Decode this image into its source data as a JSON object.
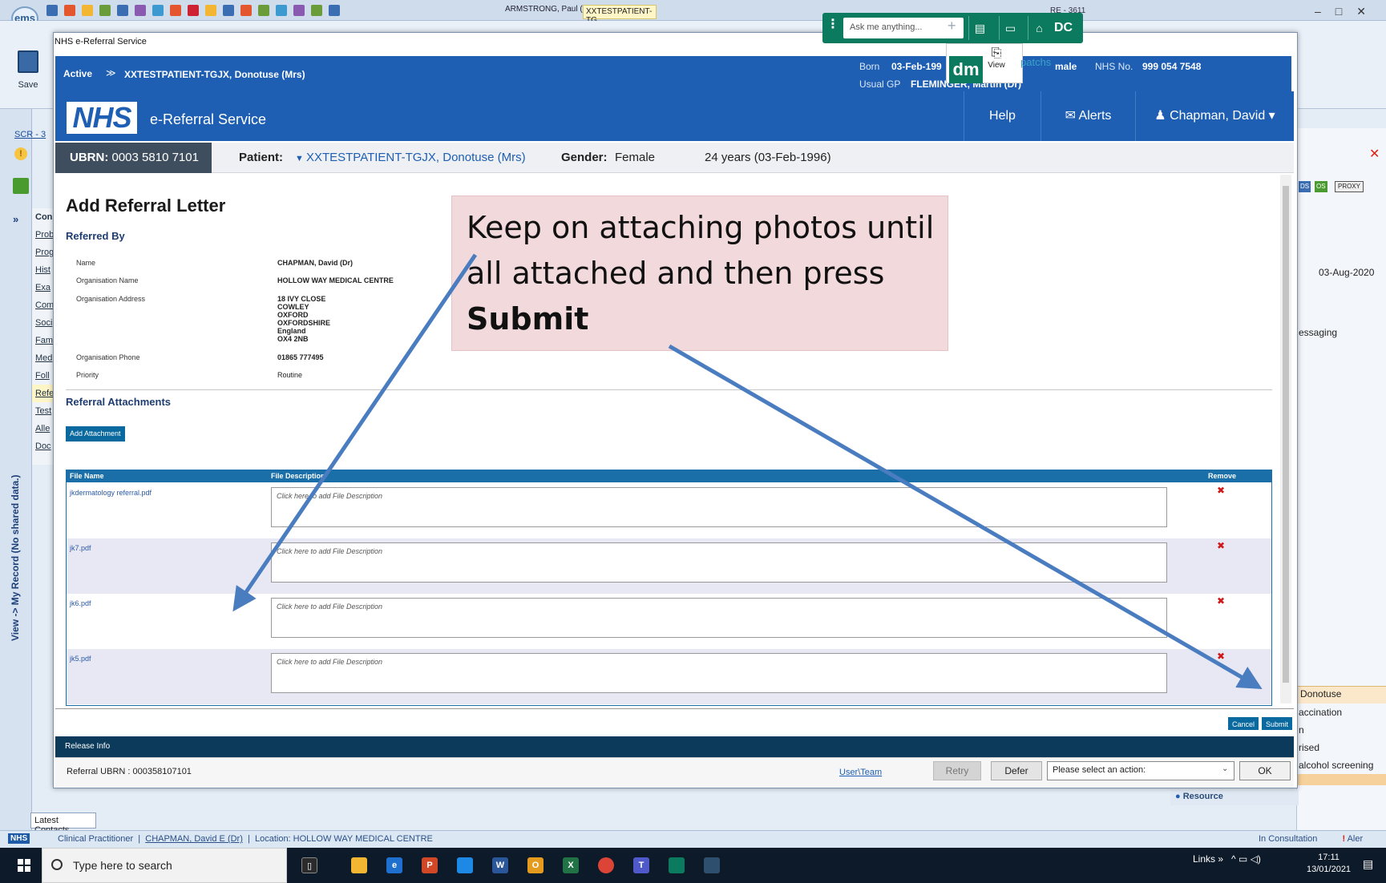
{
  "emis": {
    "logo": "ems",
    "tabs_text": "ARMSTRONG, Paul (...",
    "active_tab": "XXTESTPATIENT-TG...",
    "window_title_fragment": "RE - 3611",
    "save_label": "Save",
    "scr_link": "SCR - 3",
    "left_nav": [
      "Cons",
      "Prob",
      "Prog",
      "Hist",
      "Exa",
      "Com",
      "Soci",
      "Fam",
      "Med",
      "Foll",
      "Refe",
      "Test",
      "Alle",
      "Doc"
    ],
    "vertical_label": "View -> My Record (No shared data.)",
    "right_panel": {
      "badges": [
        "DS",
        "OS",
        "PROXY"
      ],
      "date": "03-Aug-2020",
      "messaging": "essaging",
      "patient_short": "Donotuse",
      "items": [
        "accination",
        "n",
        "rised",
        "alcohol screening"
      ]
    },
    "resource_label": "Resource",
    "latest_contacts": "Latest Contacts",
    "status_bar": {
      "nhs": "NHS",
      "role": "Clinical Practitioner",
      "user": "CHAPMAN, David E (Dr)",
      "location": "Location: HOLLOW WAY MEDICAL CENTRE",
      "in_consultation": "In Consultation",
      "alerts": "Aler"
    }
  },
  "taskbar": {
    "search_placeholder": "Type here to search",
    "links_label": "Links",
    "time": "17:11",
    "date": "13/01/2021"
  },
  "dm_toolbar": {
    "ask_placeholder": "Ask me anything...",
    "dc_label": "DC",
    "logo": "dm",
    "view_label": "View",
    "patchs_label": "patchs"
  },
  "dialog": {
    "window_title": "NHS e-Referral Service",
    "banner": {
      "status": "Active",
      "patient_name": "XXTESTPATIENT-TGJX, Donotuse (Mrs)",
      "born_label": "Born",
      "born_value": "03-Feb-199",
      "usual_gp_label": "Usual GP",
      "usual_gp_value": "FLEMINGER, Martin (Dr)",
      "gender_value": "male",
      "nhs_no_label": "NHS No.",
      "nhs_no_value": "999 054 7548"
    },
    "ers_header": {
      "logo": "NHS",
      "title": "e-Referral Service",
      "help": "Help",
      "alerts": "Alerts",
      "user": "Chapman, David"
    },
    "ubrn_bar": {
      "ubrn_label": "UBRN:",
      "ubrn_value": "0003 5810 7101",
      "patient_label": "Patient:",
      "patient_value": "XXTESTPATIENT-TGJX, Donotuse (Mrs)",
      "gender_label": "Gender:",
      "gender_value": "Female",
      "age": "24 years (03-Feb-1996)"
    },
    "page_title": "Add Referral Letter",
    "referred_by": {
      "heading": "Referred By",
      "fields": [
        {
          "label": "Name",
          "value": "CHAPMAN, David (Dr)"
        },
        {
          "label": "Organisation Name",
          "value": "HOLLOW WAY MEDICAL CENTRE"
        },
        {
          "label": "Organisation Address",
          "value": "18 IVY CLOSE\nCOWLEY\nOXFORD\nOXFORDSHIRE\nEngland\nOX4 2NB"
        },
        {
          "label": "Organisation Phone",
          "value": "01865 777495"
        },
        {
          "label": "Priority",
          "value": "Routine"
        }
      ]
    },
    "attachments": {
      "heading": "Referral Attachments",
      "add_button": "Add Attachment",
      "columns": {
        "file_name": "File Name",
        "file_description": "File Description",
        "remove": "Remove"
      },
      "rows": [
        {
          "file_name": "jkdermatology referral.pdf",
          "description_placeholder": "Click here to add File Description"
        },
        {
          "file_name": "jk7.pdf",
          "description_placeholder": "Click here to add File Description"
        },
        {
          "file_name": "jk6.pdf",
          "description_placeholder": "Click here to add File Description"
        },
        {
          "file_name": "jk5.pdf",
          "description_placeholder": "Click here to add File Description"
        }
      ]
    },
    "cancel_label": "Cancel",
    "submit_label": "Submit",
    "release_info": "Release Info",
    "referral_ubrn": "Referral UBRN : 000358107101",
    "user_team": "User\\Team",
    "retry": "Retry",
    "defer": "Defer",
    "action_placeholder": "Please select an action:",
    "ok": "OK"
  },
  "callout": {
    "text_before": "Keep on attaching photos until all attached and then press ",
    "text_bold": "Submit",
    "arrow_color": "#4a7cc0"
  }
}
